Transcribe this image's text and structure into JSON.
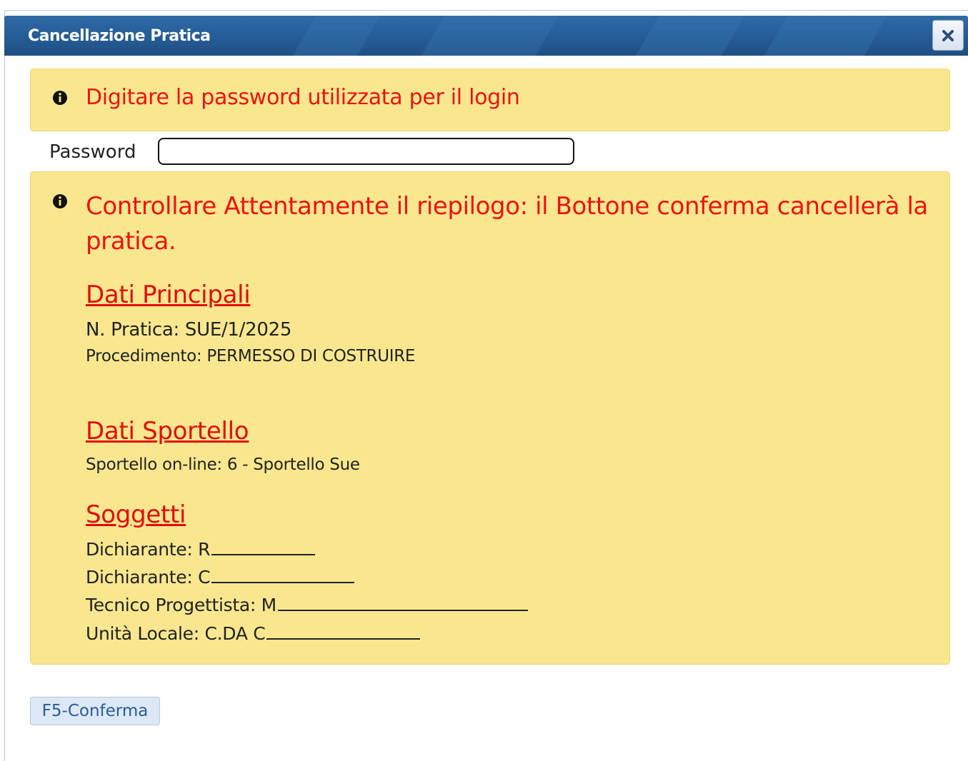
{
  "dialog": {
    "title": "Cancellazione Pratica",
    "close_icon": "close-icon"
  },
  "alert_login": {
    "icon": "info-icon",
    "text": "Digitare la password utilizzata per il login"
  },
  "password": {
    "label": "Password",
    "value": ""
  },
  "summary": {
    "icon": "info-icon",
    "warning": "Controllare Attentamente il riepilogo: il Bottone conferma cancellerà la pratica.",
    "sections": {
      "principali": {
        "title": "Dati Principali",
        "n_pratica": "N. Pratica: SUE/1/2025",
        "procedimento": "Procedimento: PERMESSO DI COSTRUIRE"
      },
      "sportello": {
        "title": "Dati Sportello",
        "sportello_online": "Sportello on-line: 6 - Sportello Sue"
      },
      "soggetti": {
        "title": "Soggetti",
        "dichiarante_1": "Dichiarante: R",
        "dichiarante_2": "Dichiarante: C",
        "tecnico": "Tecnico Progettista: M",
        "unita_locale": "Unità Locale: C.DA  C"
      }
    }
  },
  "actions": {
    "confirm_label": "F5-Conferma"
  },
  "colors": {
    "titlebar": "#255c95",
    "alert_bg": "#f9e78f",
    "alert_text": "#ef1111",
    "button_bg": "#dde8f6"
  }
}
